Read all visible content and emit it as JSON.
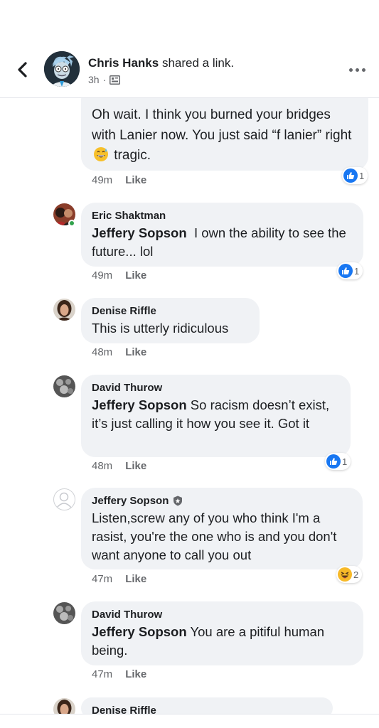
{
  "header": {
    "author": "Chris Hanks",
    "action": "shared a link.",
    "time": "3h"
  },
  "comments": [
    {
      "author": "",
      "mention": "",
      "text": "Oh wait. I think you burned your bridges with Lanier now. You just said “f lanier” right",
      "text_after": "tragic.",
      "time": "49m",
      "like": "Like",
      "reaction_count": "1"
    },
    {
      "author": "Eric Shaktman",
      "mention": "Jeffery Sopson",
      "text": "I own the ability to see the future... lol",
      "time": "49m",
      "like": "Like",
      "reaction_count": "1"
    },
    {
      "author": "Denise Riffle",
      "mention": "",
      "text": "This is utterly ridiculous",
      "time": "48m",
      "like": "Like"
    },
    {
      "author": "David Thurow",
      "mention": "Jeffery Sopson",
      "text": "So racism doesn’t exist, it’s just calling it how you see it. Got it",
      "time": "48m",
      "like": "Like",
      "reaction_count": "1"
    },
    {
      "author": "Jeffery Sopson",
      "mention": "",
      "text": "Listen,screw any of you who think I'm a rasist, you're the one who is and you don't want anyone to call you out",
      "time": "47m",
      "like": "Like",
      "reaction_count": "2"
    },
    {
      "author": "David Thurow",
      "mention": "Jeffery Sopson",
      "text": "You are a pitiful human being.",
      "time": "47m",
      "like": "Like"
    },
    {
      "author": "Denise Riffle"
    }
  ],
  "colors": {
    "accent": "#1877f2",
    "bubble": "#f0f2f5",
    "muted": "#65676b",
    "online": "#31a24c"
  },
  "icons": [
    "back-arrow-icon",
    "more-icon",
    "photo-icon",
    "like-reaction-icon",
    "haha-reaction-icon",
    "admin-badge-icon"
  ]
}
